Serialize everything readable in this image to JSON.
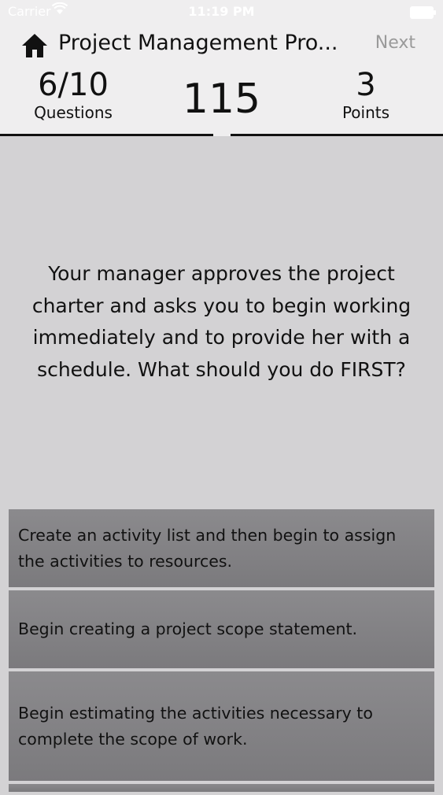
{
  "statusbar": {
    "carrier": "Carrier",
    "time": "11:19 PM"
  },
  "nav": {
    "title": "Project Management Pro...",
    "next_label": "Next"
  },
  "stats": {
    "questions_value": "6/10",
    "questions_label": "Questions",
    "score": "115",
    "points_value": "3",
    "points_label": "Points"
  },
  "question": {
    "text": "Your manager approves the project charter and asks you to begin working immediately and to provide her with a schedule. What should you do FIRST?"
  },
  "answers": [
    {
      "text": "Create an activity list and then begin to assign the activities to resources."
    },
    {
      "text": "Begin creating a project scope statement."
    },
    {
      "text": "Begin estimating the activities necessary to complete the scope of work."
    }
  ]
}
